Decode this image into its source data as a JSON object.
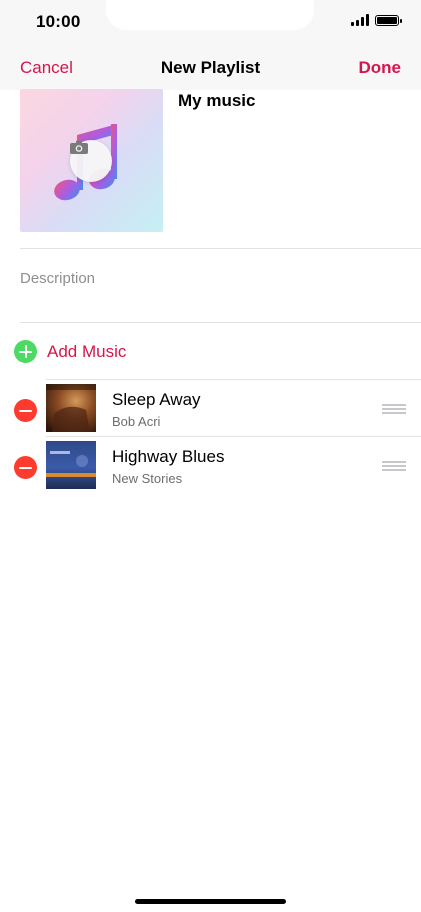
{
  "status_bar": {
    "time": "10:00",
    "icons": [
      "cellular-signal-icon",
      "battery-icon"
    ]
  },
  "nav": {
    "cancel_label": "Cancel",
    "title": "New Playlist",
    "done_label": "Done",
    "accent_color": "#d3164d"
  },
  "playlist": {
    "name": "My music",
    "description_placeholder": "Description",
    "artwork_icon": "music-note-icon",
    "camera_icon": "camera-icon"
  },
  "add_music": {
    "label": "Add Music",
    "icon": "add-circle-icon",
    "icon_color": "#4cd964"
  },
  "songs": [
    {
      "title": "Sleep Away",
      "artist": "Bob Acri"
    },
    {
      "title": "Highway Blues",
      "artist": "New Stories"
    }
  ],
  "song_controls": {
    "remove_icon": "remove-circle-icon",
    "remove_color": "#ff3b30",
    "reorder_icon": "reorder-grabber-icon"
  }
}
